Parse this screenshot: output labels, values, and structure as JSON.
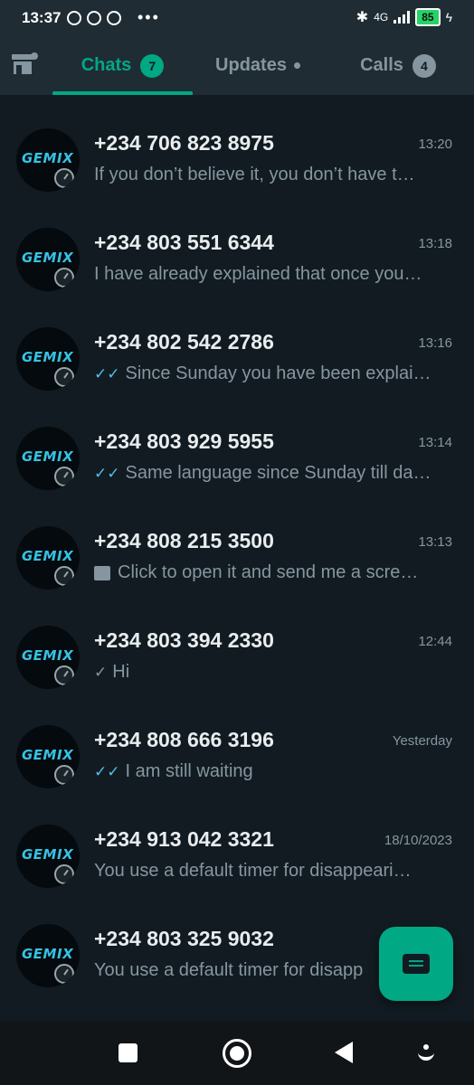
{
  "status_bar": {
    "time": "13:37",
    "network": "4G",
    "battery": "85"
  },
  "tabs": {
    "chats": {
      "label": "Chats",
      "badge": "7"
    },
    "updates": {
      "label": "Updates"
    },
    "calls": {
      "label": "Calls",
      "badge": "4"
    }
  },
  "chats": [
    {
      "name": "+234 706 823 8975",
      "time": "13:20",
      "message": "If you don’t believe it, you don’t have t…",
      "status": "none"
    },
    {
      "name": "+234 803 551 6344",
      "time": "13:18",
      "message": "I have already explained that once you…",
      "status": "none"
    },
    {
      "name": "+234 802 542 2786",
      "time": "13:16",
      "message": "Since Sunday you have been explai…",
      "status": "read"
    },
    {
      "name": "+234 803 929 5955",
      "time": "13:14",
      "message": "Same language since Sunday till da…",
      "status": "read"
    },
    {
      "name": "+234 808 215 3500",
      "time": "13:13",
      "message": "Click to open it and send me a scre…",
      "status": "image"
    },
    {
      "name": "+234 803 394 2330",
      "time": "12:44",
      "message": "Hi",
      "status": "sent"
    },
    {
      "name": "+234 808 666 3196",
      "time": "Yesterday",
      "message": "I am still waiting",
      "status": "read"
    },
    {
      "name": "+234 913 042 3321",
      "time": "18/10/2023",
      "message": "You use a default timer for disappeari…",
      "status": "none"
    },
    {
      "name": "+234 803 325 9032",
      "time": "",
      "message": "You use a default timer for disapp",
      "status": "none"
    }
  ],
  "avatar_logo": "GEMIX",
  "colors": {
    "accent": "#00a884",
    "background": "#111b21",
    "header": "#1f2c34",
    "read_tick": "#53bdeb"
  },
  "icons": {
    "store": "store-icon",
    "fab": "new-chat-icon"
  }
}
